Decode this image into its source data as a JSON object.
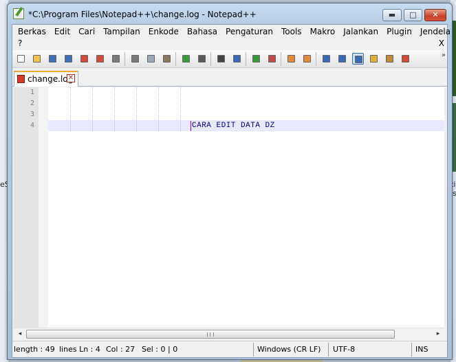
{
  "window": {
    "title": "*C:\\Program Files\\Notepad++\\change.log - Notepad++",
    "minimize_glyph": "▬",
    "maximize_glyph": "□",
    "close_glyph": "✕"
  },
  "menu": {
    "items": [
      "Berkas",
      "Edit",
      "Cari",
      "Tampilan",
      "Enkode",
      "Bahasa",
      "Pengaturan",
      "Tools",
      "Makro",
      "Jalankan",
      "Plugin",
      "Jendela"
    ],
    "help": "?",
    "close_doc": "X"
  },
  "toolbar": {
    "buttons": [
      {
        "name": "new-file-icon",
        "color": "#ffffff"
      },
      {
        "name": "open-file-icon",
        "color": "#f3c24b"
      },
      {
        "name": "save-icon",
        "color": "#3e6fb5"
      },
      {
        "name": "save-all-icon",
        "color": "#3e6fb5"
      },
      {
        "name": "close-icon",
        "color": "#d44a3a"
      },
      {
        "name": "close-all-icon",
        "color": "#d44a3a"
      },
      {
        "name": "print-icon",
        "color": "#7a7a7a"
      },
      {
        "name": "cut-icon",
        "color": "#7a7a7a"
      },
      {
        "name": "copy-icon",
        "color": "#9aa8b8"
      },
      {
        "name": "paste-icon",
        "color": "#8a7a5a"
      },
      {
        "name": "undo-icon",
        "color": "#3a9a3a"
      },
      {
        "name": "redo-icon",
        "color": "#5a5a5a"
      },
      {
        "name": "find-icon",
        "color": "#444444"
      },
      {
        "name": "replace-icon",
        "color": "#3a6ab5"
      },
      {
        "name": "zoom-in-icon",
        "color": "#3a9a3a"
      },
      {
        "name": "zoom-out-icon",
        "color": "#c04a4a"
      },
      {
        "name": "sync-vertical-icon",
        "color": "#e08a3a"
      },
      {
        "name": "sync-horizontal-icon",
        "color": "#e08a3a"
      },
      {
        "name": "word-wrap-icon",
        "color": "#3a6ab5"
      },
      {
        "name": "show-all-chars-icon",
        "color": "#3a6ab5"
      },
      {
        "name": "indent-guide-icon",
        "color": "#3a6ab5"
      },
      {
        "name": "doc-map-icon",
        "color": "#e0b03a"
      },
      {
        "name": "function-list-icon",
        "color": "#c08a3a"
      },
      {
        "name": "macro-record-icon",
        "color": "#d04a3a"
      }
    ],
    "more_glyph": "»"
  },
  "tab": {
    "label": "change.log",
    "close_glyph": "✕"
  },
  "editor": {
    "line_numbers": [
      "1",
      "2",
      "3",
      "4"
    ],
    "lines": [
      "",
      "",
      "",
      "CARA EDIT DATA DZ"
    ]
  },
  "scrollbar": {
    "left_glyph": "◂",
    "right_glyph": "▸"
  },
  "status": {
    "length": "length : 49",
    "lines": "lines Ln : 4",
    "col": "Col : 27",
    "sel": "Sel : 0 | 0",
    "eol": "Windows (CR LF)",
    "encoding": "UTF-8",
    "mode": "INS"
  },
  "background": {
    "left_fragment": "eS",
    "right_fragment": "ti ls"
  }
}
